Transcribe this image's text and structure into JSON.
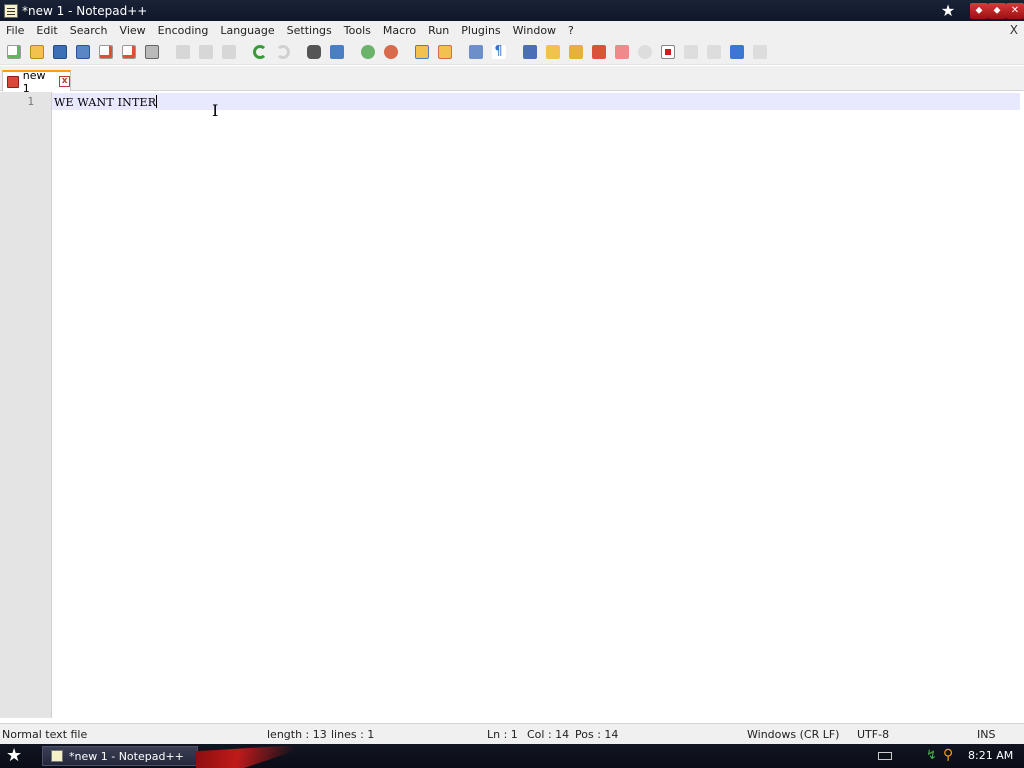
{
  "window": {
    "title": "*new 1 - Notepad++",
    "controls": [
      "pin-icon",
      "minimize-icon",
      "maximize-icon",
      "close-icon"
    ]
  },
  "menu": {
    "items": [
      "File",
      "Edit",
      "Search",
      "View",
      "Encoding",
      "Language",
      "Settings",
      "Tools",
      "Macro",
      "Run",
      "Plugins",
      "Window",
      "?"
    ],
    "close_label": "X"
  },
  "toolbar": {
    "icons": [
      "new-file-icon",
      "open-file-icon",
      "save-icon",
      "save-all-icon",
      "close-icon",
      "close-all-icon",
      "print-icon",
      "cut-icon",
      "copy-icon",
      "paste-icon",
      "undo-icon",
      "redo-icon",
      "find-icon",
      "replace-icon",
      "zoom-in-icon",
      "zoom-out-icon",
      "sync-vertical-icon",
      "sync-horizontal-icon",
      "word-wrap-icon",
      "show-all-chars-icon",
      "indent-guide-icon",
      "folder-icon",
      "map-icon",
      "function-list-icon",
      "doc-map-icon",
      "stop-record-icon",
      "record-macro-icon",
      "play-macro-icon",
      "run-macro-icon",
      "run-multiple-icon",
      "save-macro-icon"
    ]
  },
  "tabs": [
    {
      "label": "new 1",
      "close_label": "x"
    }
  ],
  "editor": {
    "line_number": "1",
    "line_text": "WE WANT INTER"
  },
  "status": {
    "file_type": "Normal text file",
    "length": "length : 13",
    "lines": "lines : 1",
    "ln": "Ln : 1",
    "col": "Col : 14",
    "pos": "Pos : 14",
    "eol": "Windows (CR LF)",
    "encoding": "UTF-8",
    "mode": "INS"
  },
  "taskbar": {
    "task_label": "*new 1 - Notepad++",
    "time": "8:21 AM"
  },
  "colors": {
    "title_bg": "#10172a",
    "tab_accent": "#f6a100",
    "current_line": "#e8e8ff",
    "close_red": "#c23a2e"
  }
}
